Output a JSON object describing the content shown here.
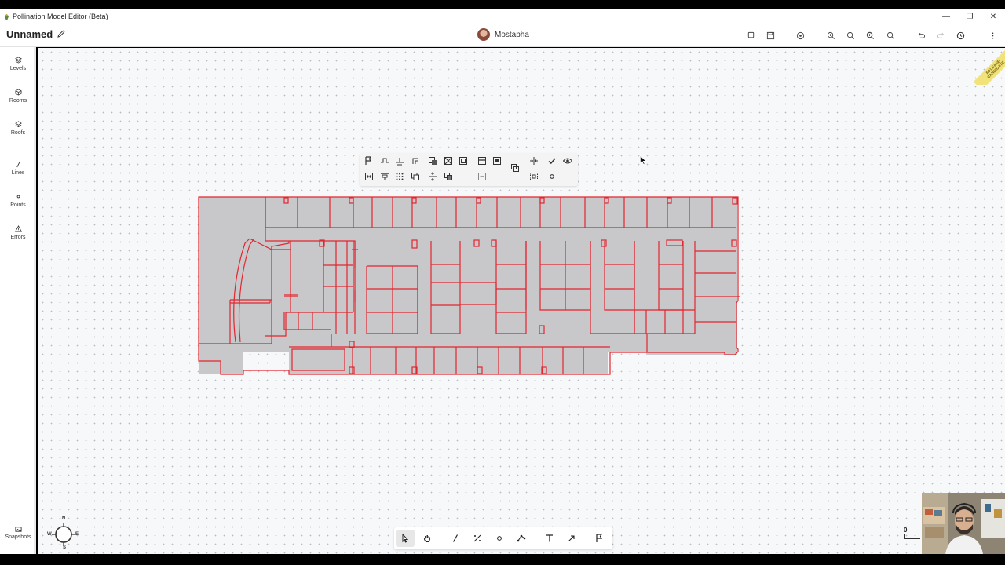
{
  "window": {
    "title": "Pollination Model Editor (Beta)",
    "minimize": "—",
    "maximize": "❐",
    "close": "✕"
  },
  "header": {
    "doc_name": "Unnamed",
    "user_name": "Mostapha",
    "icons": [
      "download-icon",
      "save-icon",
      "target-icon",
      "zoom-in-icon",
      "zoom-out-icon",
      "zoom-extents-icon",
      "zoom-fit-icon",
      "undo-icon",
      "redo-icon",
      "history-icon",
      "more-icon"
    ]
  },
  "sidebar": {
    "items": [
      {
        "label": "Levels",
        "icon": "layers-icon"
      },
      {
        "label": "Rooms",
        "icon": "cube-icon"
      },
      {
        "label": "Roofs",
        "icon": "roof-icon"
      },
      {
        "label": "Lines",
        "icon": "line-icon"
      },
      {
        "label": "Points",
        "icon": "point-icon"
      },
      {
        "label": "Errors",
        "icon": "warning-icon"
      }
    ],
    "snapshots_label": "Snapshots"
  },
  "badge": {
    "line1": "RELEASE",
    "line2": "CANDIDATE",
    "color": "#f2e27a"
  },
  "compass": {
    "n": "N",
    "s": "S",
    "e": "E",
    "w": "W"
  },
  "scale": {
    "zero": "0"
  },
  "colors": {
    "room_stroke": "#e3262f",
    "room_fill": "#c8c8ca",
    "canvas_bg": "#f7f8f9"
  }
}
